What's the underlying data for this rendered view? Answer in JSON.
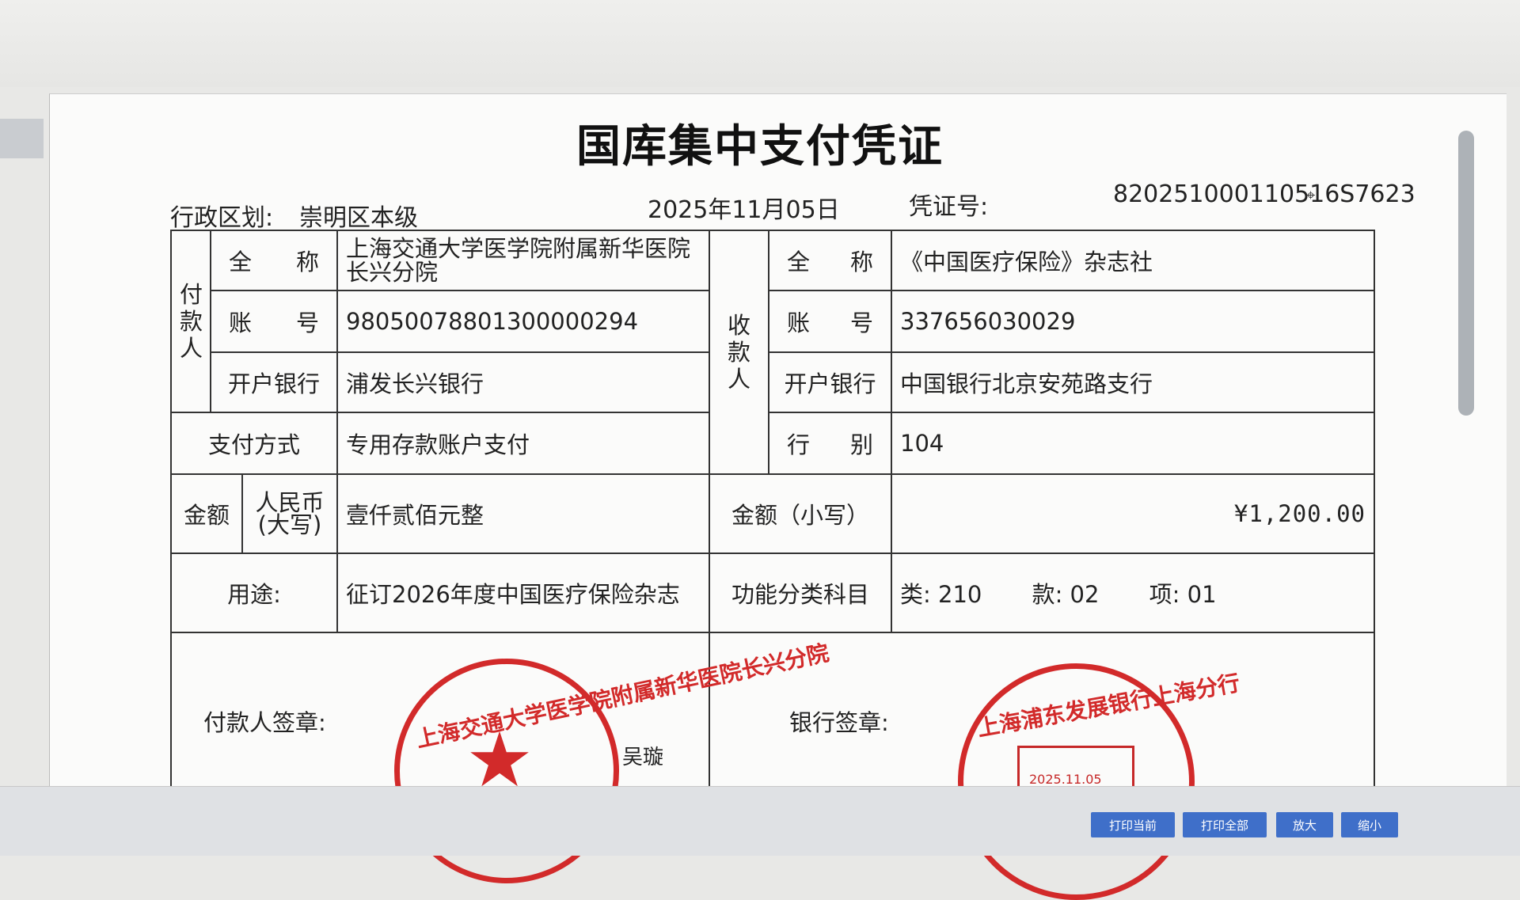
{
  "voucher": {
    "title": "国库集中支付凭证",
    "region_label": "行政区划:",
    "region_value": "崇明区本级",
    "date": "2025年11月05日",
    "voucher_no_label": "凭证号:",
    "voucher_no": "820251000110516S7623"
  },
  "payer": {
    "group_label": "付款人",
    "name_label": "全  称",
    "name": "上海交通大学医学院附属新华医院长兴分院",
    "account_label": "账  号",
    "account": "98050078801300000294",
    "bank_label": "开户银行",
    "bank": "浦发长兴银行"
  },
  "payee": {
    "group_label": "收款人",
    "name_label": "全  称",
    "name": "《中国医疗保险》杂志社",
    "account_label": "账  号",
    "account": "337656030029",
    "bank_label": "开户银行",
    "bank": "中国银行北京安苑路支行",
    "type_label": "行  别",
    "type": "104"
  },
  "payment": {
    "method_label": "支付方式",
    "method": "专用存款账户支付",
    "amount_label": "金额",
    "rmb_label": "人民币(大写)",
    "amount_upper": "壹仟贰佰元整",
    "amount_small_label": "金额（小写）",
    "amount_small": "¥1,200.00",
    "purpose_label": "用途:",
    "purpose": "征订2026年度中国医疗保险杂志",
    "func_label": "功能分类科目",
    "func_lei": "类: 210",
    "func_kuan": "款: 02",
    "func_xiang": "项: 01"
  },
  "signatures": {
    "payer_label": "付款人签章:",
    "payer_seal_text": "上海交通大学医学院附属新华医院长兴分院",
    "signer_name": "吴璇",
    "bank_label": "银行签章:",
    "bank_seal_text": "上海浦东发展银行上海分行",
    "bank_stamp_date": "2025.11.05"
  },
  "buttons": {
    "print_current": "打印当前",
    "print_all": "打印全部",
    "zoom_in": "放大",
    "zoom_out": "缩小"
  },
  "colors": {
    "seal": "#d22a2a",
    "button": "#3f6fc9"
  }
}
